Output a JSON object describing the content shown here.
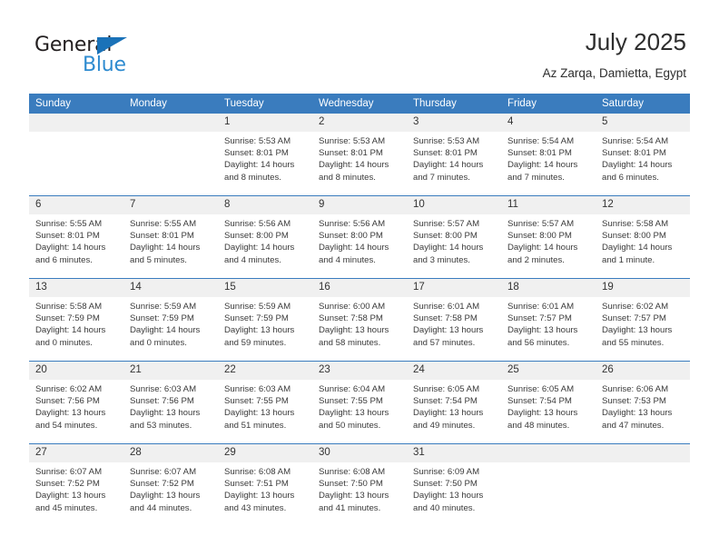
{
  "logo": {
    "word_one": "General",
    "word_two": "Blue",
    "triangle_color": "#1a72b8",
    "blue_text_color": "#2e8bd0",
    "icon": "general-blue-logo"
  },
  "header": {
    "title": "July 2025",
    "subtitle": "Az Zarqa, Damietta, Egypt",
    "accent_color": "#3a7cbe"
  },
  "calendar": {
    "weekday_headers": [
      "Sunday",
      "Monday",
      "Tuesday",
      "Wednesday",
      "Thursday",
      "Friday",
      "Saturday"
    ],
    "labels": {
      "sunrise": "Sunrise:",
      "sunset": "Sunset:",
      "daylight": "Daylight:"
    },
    "weeks": [
      [
        {
          "day": "",
          "sunrise": "",
          "sunset": "",
          "daylight": "",
          "blank": true
        },
        {
          "day": "",
          "sunrise": "",
          "sunset": "",
          "daylight": "",
          "blank": true
        },
        {
          "day": "1",
          "sunrise": "Sunrise: 5:53 AM",
          "sunset": "Sunset: 8:01 PM",
          "daylight": "Daylight: 14 hours and 8 minutes."
        },
        {
          "day": "2",
          "sunrise": "Sunrise: 5:53 AM",
          "sunset": "Sunset: 8:01 PM",
          "daylight": "Daylight: 14 hours and 8 minutes."
        },
        {
          "day": "3",
          "sunrise": "Sunrise: 5:53 AM",
          "sunset": "Sunset: 8:01 PM",
          "daylight": "Daylight: 14 hours and 7 minutes."
        },
        {
          "day": "4",
          "sunrise": "Sunrise: 5:54 AM",
          "sunset": "Sunset: 8:01 PM",
          "daylight": "Daylight: 14 hours and 7 minutes."
        },
        {
          "day": "5",
          "sunrise": "Sunrise: 5:54 AM",
          "sunset": "Sunset: 8:01 PM",
          "daylight": "Daylight: 14 hours and 6 minutes."
        }
      ],
      [
        {
          "day": "6",
          "sunrise": "Sunrise: 5:55 AM",
          "sunset": "Sunset: 8:01 PM",
          "daylight": "Daylight: 14 hours and 6 minutes."
        },
        {
          "day": "7",
          "sunrise": "Sunrise: 5:55 AM",
          "sunset": "Sunset: 8:01 PM",
          "daylight": "Daylight: 14 hours and 5 minutes."
        },
        {
          "day": "8",
          "sunrise": "Sunrise: 5:56 AM",
          "sunset": "Sunset: 8:00 PM",
          "daylight": "Daylight: 14 hours and 4 minutes."
        },
        {
          "day": "9",
          "sunrise": "Sunrise: 5:56 AM",
          "sunset": "Sunset: 8:00 PM",
          "daylight": "Daylight: 14 hours and 4 minutes."
        },
        {
          "day": "10",
          "sunrise": "Sunrise: 5:57 AM",
          "sunset": "Sunset: 8:00 PM",
          "daylight": "Daylight: 14 hours and 3 minutes."
        },
        {
          "day": "11",
          "sunrise": "Sunrise: 5:57 AM",
          "sunset": "Sunset: 8:00 PM",
          "daylight": "Daylight: 14 hours and 2 minutes."
        },
        {
          "day": "12",
          "sunrise": "Sunrise: 5:58 AM",
          "sunset": "Sunset: 8:00 PM",
          "daylight": "Daylight: 14 hours and 1 minute."
        }
      ],
      [
        {
          "day": "13",
          "sunrise": "Sunrise: 5:58 AM",
          "sunset": "Sunset: 7:59 PM",
          "daylight": "Daylight: 14 hours and 0 minutes."
        },
        {
          "day": "14",
          "sunrise": "Sunrise: 5:59 AM",
          "sunset": "Sunset: 7:59 PM",
          "daylight": "Daylight: 14 hours and 0 minutes."
        },
        {
          "day": "15",
          "sunrise": "Sunrise: 5:59 AM",
          "sunset": "Sunset: 7:59 PM",
          "daylight": "Daylight: 13 hours and 59 minutes."
        },
        {
          "day": "16",
          "sunrise": "Sunrise: 6:00 AM",
          "sunset": "Sunset: 7:58 PM",
          "daylight": "Daylight: 13 hours and 58 minutes."
        },
        {
          "day": "17",
          "sunrise": "Sunrise: 6:01 AM",
          "sunset": "Sunset: 7:58 PM",
          "daylight": "Daylight: 13 hours and 57 minutes."
        },
        {
          "day": "18",
          "sunrise": "Sunrise: 6:01 AM",
          "sunset": "Sunset: 7:57 PM",
          "daylight": "Daylight: 13 hours and 56 minutes."
        },
        {
          "day": "19",
          "sunrise": "Sunrise: 6:02 AM",
          "sunset": "Sunset: 7:57 PM",
          "daylight": "Daylight: 13 hours and 55 minutes."
        }
      ],
      [
        {
          "day": "20",
          "sunrise": "Sunrise: 6:02 AM",
          "sunset": "Sunset: 7:56 PM",
          "daylight": "Daylight: 13 hours and 54 minutes."
        },
        {
          "day": "21",
          "sunrise": "Sunrise: 6:03 AM",
          "sunset": "Sunset: 7:56 PM",
          "daylight": "Daylight: 13 hours and 53 minutes."
        },
        {
          "day": "22",
          "sunrise": "Sunrise: 6:03 AM",
          "sunset": "Sunset: 7:55 PM",
          "daylight": "Daylight: 13 hours and 51 minutes."
        },
        {
          "day": "23",
          "sunrise": "Sunrise: 6:04 AM",
          "sunset": "Sunset: 7:55 PM",
          "daylight": "Daylight: 13 hours and 50 minutes."
        },
        {
          "day": "24",
          "sunrise": "Sunrise: 6:05 AM",
          "sunset": "Sunset: 7:54 PM",
          "daylight": "Daylight: 13 hours and 49 minutes."
        },
        {
          "day": "25",
          "sunrise": "Sunrise: 6:05 AM",
          "sunset": "Sunset: 7:54 PM",
          "daylight": "Daylight: 13 hours and 48 minutes."
        },
        {
          "day": "26",
          "sunrise": "Sunrise: 6:06 AM",
          "sunset": "Sunset: 7:53 PM",
          "daylight": "Daylight: 13 hours and 47 minutes."
        }
      ],
      [
        {
          "day": "27",
          "sunrise": "Sunrise: 6:07 AM",
          "sunset": "Sunset: 7:52 PM",
          "daylight": "Daylight: 13 hours and 45 minutes."
        },
        {
          "day": "28",
          "sunrise": "Sunrise: 6:07 AM",
          "sunset": "Sunset: 7:52 PM",
          "daylight": "Daylight: 13 hours and 44 minutes."
        },
        {
          "day": "29",
          "sunrise": "Sunrise: 6:08 AM",
          "sunset": "Sunset: 7:51 PM",
          "daylight": "Daylight: 13 hours and 43 minutes."
        },
        {
          "day": "30",
          "sunrise": "Sunrise: 6:08 AM",
          "sunset": "Sunset: 7:50 PM",
          "daylight": "Daylight: 13 hours and 41 minutes."
        },
        {
          "day": "31",
          "sunrise": "Sunrise: 6:09 AM",
          "sunset": "Sunset: 7:50 PM",
          "daylight": "Daylight: 13 hours and 40 minutes."
        },
        {
          "day": "",
          "sunrise": "",
          "sunset": "",
          "daylight": "",
          "blank": true
        },
        {
          "day": "",
          "sunrise": "",
          "sunset": "",
          "daylight": "",
          "blank": true
        }
      ]
    ]
  }
}
